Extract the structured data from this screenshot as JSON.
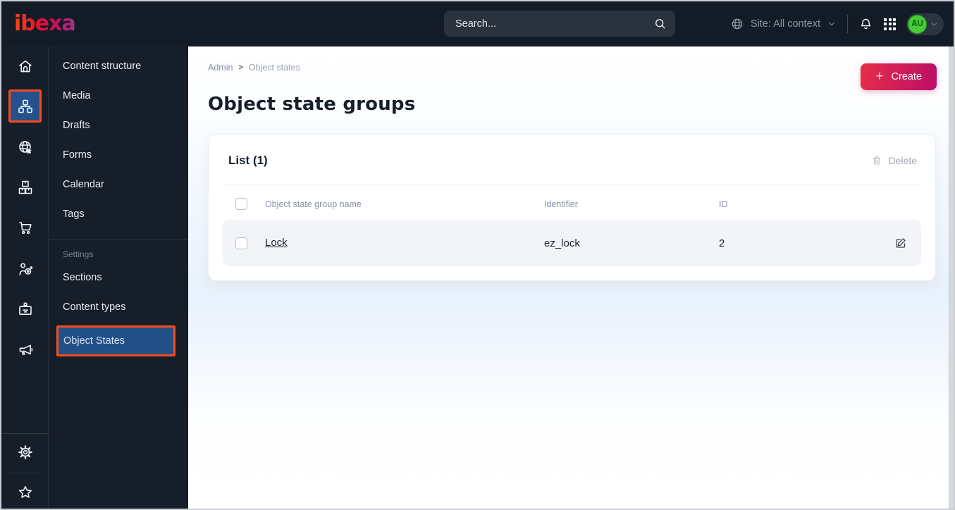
{
  "topbar": {
    "logo_text": "ibexa",
    "search_placeholder": "Search...",
    "site_context_label": "Site: All context",
    "avatar_initials": "AU"
  },
  "sidebar": {
    "menu_items": [
      "Content structure",
      "Media",
      "Drafts",
      "Forms",
      "Calendar",
      "Tags"
    ],
    "settings_label": "Settings",
    "settings_items": [
      "Sections",
      "Content types"
    ],
    "active_item": "Object States"
  },
  "main": {
    "breadcrumb": {
      "items": [
        "Admin",
        "Object states"
      ],
      "separator": ">"
    },
    "create_button": {
      "plus": "+",
      "label": "Create"
    },
    "page_title": "Object state groups",
    "list_card": {
      "title": "List (1)",
      "delete_label": "Delete",
      "columns": [
        "Object state group name",
        "Identifier",
        "ID"
      ],
      "rows": [
        {
          "name": "Lock",
          "identifier": "ez_lock",
          "id": "2"
        }
      ]
    }
  },
  "colors": {
    "topbar_bg": "#131c26",
    "sidebar_bg": "#151e29",
    "accent_orange": "#f84b1c",
    "active_blue": "#24518c",
    "create_gradient_start": "#e62e47",
    "create_gradient_end": "#bb0e68",
    "avatar_green": "#47ca36",
    "content_tint_blue": "#e8f1fc",
    "row_bg": "#f2f4f7"
  }
}
